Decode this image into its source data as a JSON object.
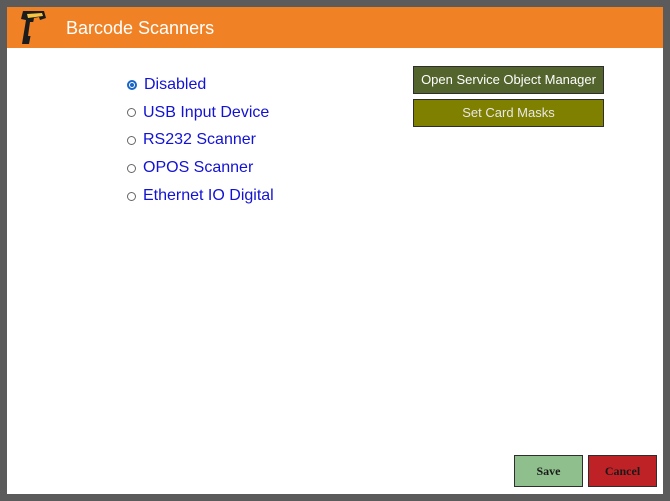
{
  "window": {
    "title": "Barcode Scanners",
    "icon": "barcode-scanner-icon",
    "accent_color": "#f08124"
  },
  "scanner_options": [
    {
      "label": "Disabled",
      "selected": true
    },
    {
      "label": "USB Input Device",
      "selected": false
    },
    {
      "label": "RS232 Scanner",
      "selected": false
    },
    {
      "label": "OPOS Scanner",
      "selected": false
    },
    {
      "label": "Ethernet IO Digital",
      "selected": false
    }
  ],
  "actions": {
    "open_ssom_label": "Open Service Object Manager",
    "set_card_masks_label": "Set Card Masks"
  },
  "footer": {
    "save_label": "Save",
    "cancel_label": "Cancel"
  }
}
